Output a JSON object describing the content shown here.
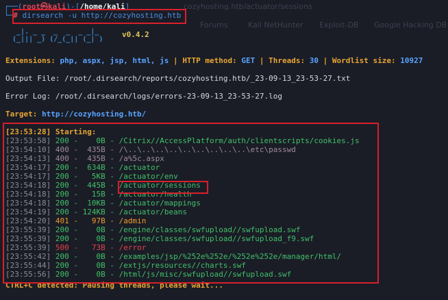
{
  "prompt": {
    "user_host": "root㉿kali",
    "path": "/home/kali",
    "command": "dirsearch -u http://cozyhosting.htb"
  },
  "background_ghost": [
    "cozyhosting.htb/actuator/sessions",
    "Forums",
    "Kali NetHunter",
    "Exploit-DB",
    "Google Hacking DB"
  ],
  "banner": {
    "logo_line1": "  _|. _ _  _  _  _ _|_",
    "logo_line2": " (_||| _) (/_(_|| (_| )",
    "version": "v0.4.2"
  },
  "config": {
    "extensions_label": "Extensions:",
    "extensions_value": "php, aspx, jsp, html, js",
    "method_label": "HTTP method:",
    "method_value": "GET",
    "threads_label": "Threads:",
    "threads_value": "30",
    "wordlist_label": "Wordlist size:",
    "wordlist_value": "10927",
    "output_file": "Output File: /root/.dirsearch/reports/cozyhosting.htb/_23-09-13_23-53-27.txt",
    "error_log": "Error Log: /root/.dirsearch/logs/errors-23-09-13_23-53-27.log",
    "target_label": "Target:",
    "target_value": "http://cozyhosting.htb/"
  },
  "results": {
    "starting": "[23:53:28] Starting:",
    "rows": [
      {
        "time": "[23:53:58]",
        "code": "200",
        "size": "0B",
        "path": "/Citrix//AccessPlatform/auth/clientscripts/cookies.js",
        "cls": "s200"
      },
      {
        "time": "[23:54:10]",
        "code": "400",
        "size": "435B",
        "path": "/\\..\\..\\..\\..\\..\\..\\..\\..\\..\\etc\\passwd",
        "cls": "s400"
      },
      {
        "time": "[23:54:13]",
        "code": "400",
        "size": "435B",
        "path": "/a%5c.aspx",
        "cls": "s400"
      },
      {
        "time": "[23:54:17]",
        "code": "200",
        "size": "634B",
        "path": "/actuator",
        "cls": "s200"
      },
      {
        "time": "[23:54:17]",
        "code": "200",
        "size": "5KB",
        "path": "/actuator/env",
        "cls": "s200"
      },
      {
        "time": "[23:54:18]",
        "code": "200",
        "size": "445B",
        "path": "/actuator/sessions",
        "cls": "s200"
      },
      {
        "time": "[23:54:18]",
        "code": "200",
        "size": "15B",
        "path": "/actuator/health",
        "cls": "s200"
      },
      {
        "time": "[23:54:18]",
        "code": "200",
        "size": "10KB",
        "path": "/actuator/mappings",
        "cls": "s200"
      },
      {
        "time": "[23:54:19]",
        "code": "200",
        "size": "124KB",
        "path": "/actuator/beans",
        "cls": "s200"
      },
      {
        "time": "[23:54:20]",
        "code": "401",
        "size": "97B",
        "path": "/admin",
        "cls": "s401"
      },
      {
        "time": "[23:55:39]",
        "code": "200",
        "size": "0B",
        "path": "/engine/classes/swfupload//swfupload.swf",
        "cls": "s200"
      },
      {
        "time": "[23:55:39]",
        "code": "200",
        "size": "0B",
        "path": "/engine/classes/swfupload//swfupload_f9.swf",
        "cls": "s200"
      },
      {
        "time": "[23:55:39]",
        "code": "500",
        "size": "73B",
        "path": "/error",
        "cls": "s500"
      },
      {
        "time": "[23:55:42]",
        "code": "200",
        "size": "0B",
        "path": "/examples/jsp/%252e%252e/%252e%252e/manager/html/",
        "cls": "s200"
      },
      {
        "time": "[23:55:44]",
        "code": "200",
        "size": "0B",
        "path": "/extjs/resources//charts.swf",
        "cls": "s200"
      },
      {
        "time": "[23:55:56]",
        "code": "200",
        "size": "0B",
        "path": "/html/js/misc/swfupload//swfupload.swf",
        "cls": "s200"
      }
    ],
    "ctrl_c": "CTRL+C detected: Pausing threads, please wait..."
  }
}
